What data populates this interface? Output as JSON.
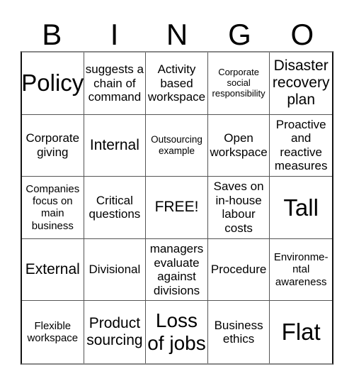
{
  "title_letters": [
    "B",
    "I",
    "N",
    "G",
    "O"
  ],
  "cells": [
    {
      "text": "Policy",
      "size": "xl"
    },
    {
      "text": "suggests a chain of command",
      "size": "m"
    },
    {
      "text": "Activity based workspace",
      "size": "m"
    },
    {
      "text": "Corporate social responsibility",
      "size": "xxs"
    },
    {
      "text": "Disaster recovery plan",
      "size": "ml"
    },
    {
      "text": "Corporate giving",
      "size": "m"
    },
    {
      "text": "Internal",
      "size": "ml"
    },
    {
      "text": "Outsourcing example",
      "size": "xs"
    },
    {
      "text": "Open workspace",
      "size": "m"
    },
    {
      "text": "Proactive and reactive measures",
      "size": "m"
    },
    {
      "text": "Companies focus on main business",
      "size": "s"
    },
    {
      "text": "Critical questions",
      "size": "m"
    },
    {
      "text": "FREE!",
      "size": "ml"
    },
    {
      "text": "Saves on in-house labour costs",
      "size": "m"
    },
    {
      "text": "Tall",
      "size": "xl"
    },
    {
      "text": "External",
      "size": "ml"
    },
    {
      "text": "Divisional",
      "size": "m"
    },
    {
      "text": "managers evaluate against divisions",
      "size": "m"
    },
    {
      "text": "Procedure",
      "size": "m"
    },
    {
      "text": "Environme-ntal awareness",
      "size": "s"
    },
    {
      "text": "Flexible workspace",
      "size": "s"
    },
    {
      "text": "Product sourcing",
      "size": "ml"
    },
    {
      "text": "Loss of jobs",
      "size": "l"
    },
    {
      "text": "Business ethics",
      "size": "m"
    },
    {
      "text": "Flat",
      "size": "xl"
    }
  ]
}
